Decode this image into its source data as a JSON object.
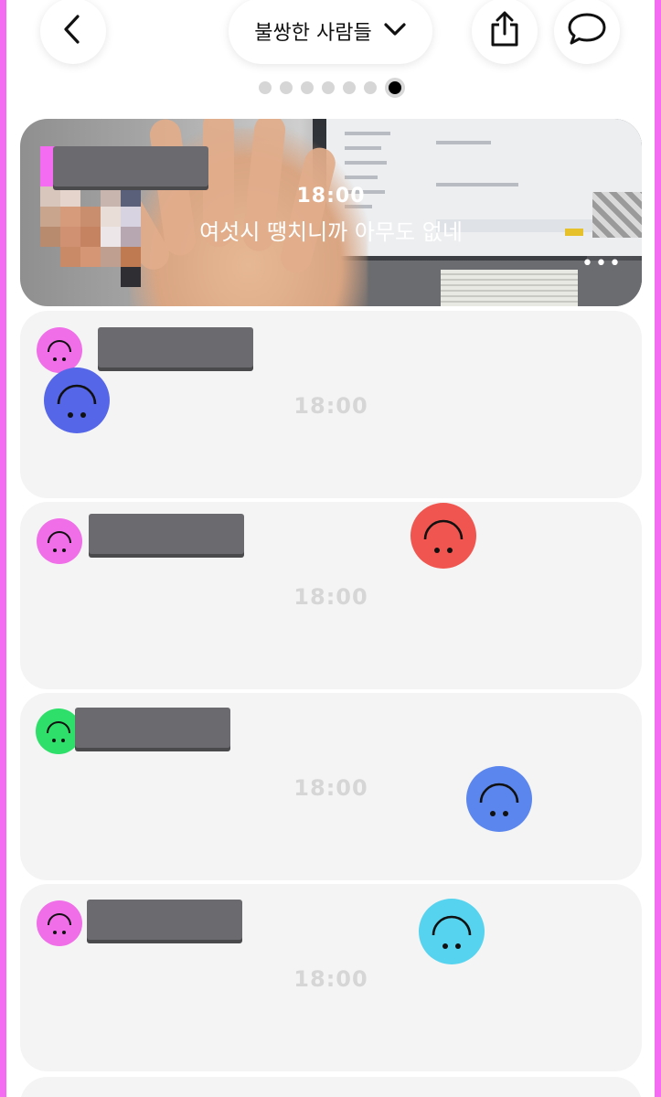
{
  "header": {
    "group_name": "불쌍한 사람들",
    "page_dots_total": 7,
    "page_dots_active_index": 6
  },
  "photo_post": {
    "time": "18:00",
    "caption": "여섯시 땡치니까 아무도 없네",
    "more": "•••"
  },
  "entries": [
    {
      "time": "18:00",
      "poster_avatar_color": "#f06ee8",
      "reaction_color": "#5566e8"
    },
    {
      "time": "18:00",
      "poster_avatar_color": "#f06ee8",
      "reaction_color": "#f0564f"
    },
    {
      "time": "18:00",
      "poster_avatar_color": "#2ee06a",
      "reaction_color": "#5b86ee"
    },
    {
      "time": "18:00",
      "poster_avatar_color": "#f06ee8",
      "reaction_color": "#56d3ef"
    }
  ],
  "colors": {
    "accent_frame": "#f36cf1",
    "card_bg": "#f4f4f4",
    "redaction": "#6b6b6f"
  },
  "icons": {
    "back": "chevron-left-icon",
    "dropdown": "chevron-down-icon",
    "share": "share-icon",
    "chat": "chat-bubble-icon",
    "reaction": "upside-down-smiley-icon"
  }
}
